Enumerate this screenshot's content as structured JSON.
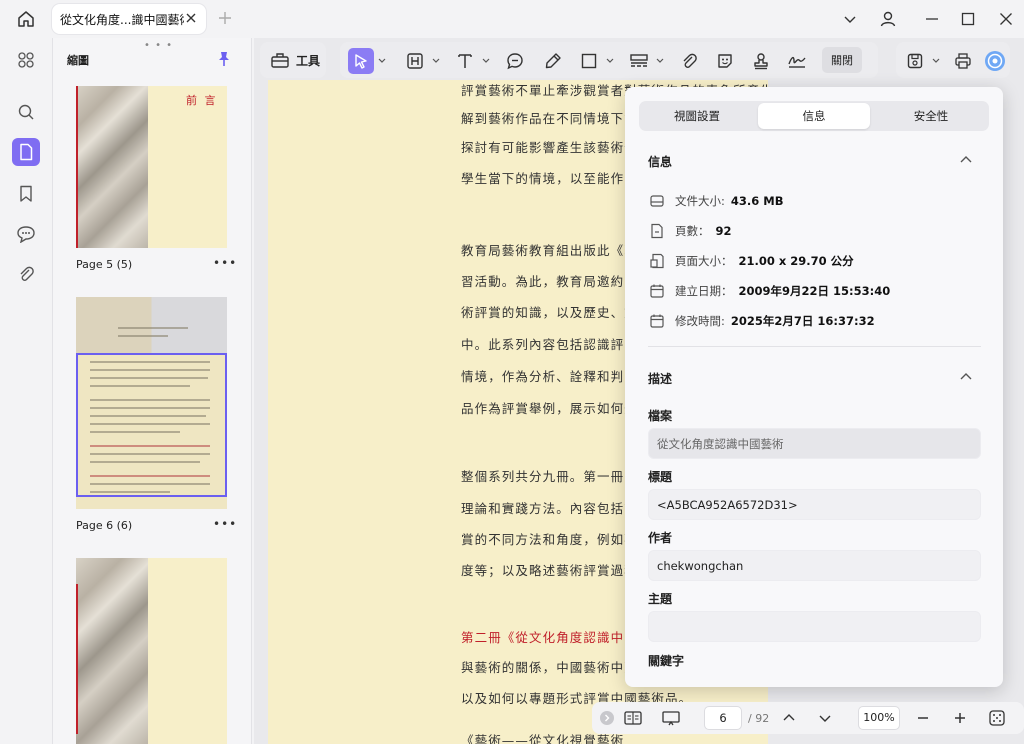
{
  "tab": {
    "title": "從文化角度...識中國藝術"
  },
  "thumbnails": {
    "panel_title": "縮圖",
    "pages": [
      {
        "caption": "Page 5 (5)",
        "heading": "前 言"
      },
      {
        "caption": "Page 6 (6)"
      },
      {
        "caption": ""
      }
    ]
  },
  "toolbar": {
    "tools_label": "工具",
    "close_label": "關閉"
  },
  "document": {
    "lines": [
      {
        "text": "評賞藝術不單止牽涉觀賞者對藝術作品的表象所產生的直接反應，更需要觀賞者深",
        "red": false
      },
      {
        "text": "解到藝術作品在不同情境下會有不同的",
        "red": false
      },
      {
        "text": "探討有可能影響產生該藝術作品的",
        "red": false
      },
      {
        "text": "學生當下的情境，以至能作出",
        "red": false
      },
      {
        "text": "教育局藝術教育組出版此《藝",
        "red": false
      },
      {
        "text": "習活動。為此，教育局邀約了",
        "red": false
      },
      {
        "text": "術評賞的知識，以及歷史、文",
        "red": false
      },
      {
        "text": "中。此系列內容包括認識評賞",
        "red": false
      },
      {
        "text": "情境，作為分析、詮釋和判斷",
        "red": false
      },
      {
        "text": "品作為評賞舉例，展示如何運",
        "red": false
      },
      {
        "text": "整個系列共分九冊。第一冊《",
        "red": false
      },
      {
        "text": "理論和實踐方法。內容包括簡",
        "red": false
      },
      {
        "text": "賞的不同方法和角度，例如觀",
        "red": false
      },
      {
        "text": "度等；以及略述藝術評賞過程",
        "red": false
      },
      {
        "text": "第二冊《從文化角度認識中國",
        "red": true
      },
      {
        "text": "與藝術的關係，中國藝術中蘊",
        "red": false
      },
      {
        "text": "以及如何以專題形式評賞中國藝術品。",
        "red": false
      },
      {
        "text": "《藝術——從文化視覺藝術",
        "red": false
      }
    ]
  },
  "properties": {
    "tabs": [
      "視圖設置",
      "信息",
      "安全性"
    ],
    "info_title": "信息",
    "info_rows": [
      {
        "label": "文件大小:",
        "value": "43.6 MB"
      },
      {
        "label": "頁數：",
        "value": "92"
      },
      {
        "label": "頁面大小：",
        "value": "21.00 x 29.70 公分"
      },
      {
        "label": "建立日期：",
        "value": "2009年9月22日 15:53:40"
      },
      {
        "label": "修改時間:",
        "value": "2025年2月7日 16:37:32"
      }
    ],
    "desc_title": "描述",
    "fields": [
      {
        "label": "檔案",
        "value": "從文化角度認識中國藝術",
        "disabled": true
      },
      {
        "label": "標題",
        "value": "<A5BCA952A6572D31>",
        "disabled": false
      },
      {
        "label": "作者",
        "value": "chekwongchan",
        "disabled": false
      },
      {
        "label": "主題",
        "value": "",
        "disabled": false
      }
    ],
    "keywords_label": "關鍵字"
  },
  "navigation": {
    "current_page": "6",
    "total_pages": "/ 92",
    "zoom": "100%"
  },
  "colors": {
    "accent": "#7f6df2",
    "page_bg": "#f7efc9",
    "red_text": "#c0202a"
  }
}
